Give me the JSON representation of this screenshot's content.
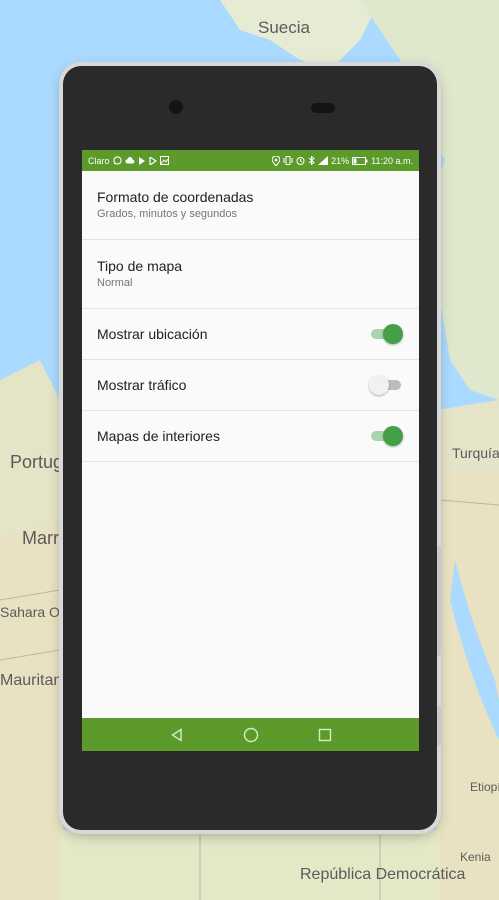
{
  "map": {
    "labels": [
      "Suecia",
      "Portugal",
      "Marruecos",
      "Sahara Occidental",
      "Mauritania",
      "Turquía",
      "Etiopía",
      "Kenia",
      "República Democrática"
    ]
  },
  "status_bar": {
    "carrier": "Claro",
    "battery": "21%",
    "time": "11:20 a.m."
  },
  "settings": [
    {
      "title": "Formato de coordenadas",
      "subtitle": "Grados, minutos y segundos"
    },
    {
      "title": "Tipo de mapa",
      "subtitle": "Normal"
    },
    {
      "title": "Mostrar ubicación",
      "toggle": true
    },
    {
      "title": "Mostrar tráfico",
      "toggle": false
    },
    {
      "title": "Mapas de interiores",
      "toggle": true
    }
  ],
  "colors": {
    "bar_green": "#5c9a2c",
    "switch_on": "#43a047",
    "map_water": "#aadaff",
    "map_land": "#e8e6c9"
  },
  "icons": [
    "whatsapp-icon",
    "cloud-icon",
    "play-icon",
    "play-icon",
    "image-icon",
    "location-icon",
    "vibrate-icon",
    "alarm-icon",
    "bluetooth-icon",
    "signal-icon",
    "battery-icon",
    "back-icon",
    "home-icon",
    "recents-icon"
  ]
}
